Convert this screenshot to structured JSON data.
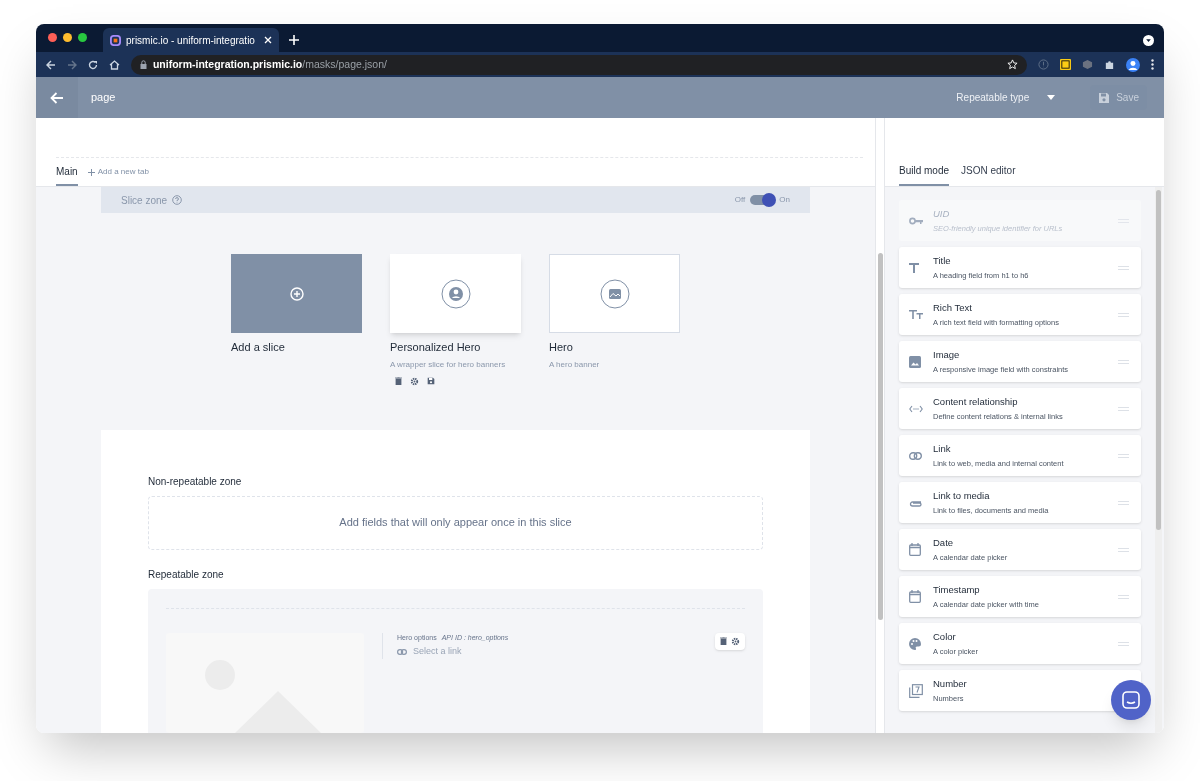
{
  "browser": {
    "tab_title": "prismic.io - uniform-integratio",
    "url_host": "uniform-integration.prismic.io",
    "url_path": "/masks/page.json/"
  },
  "header": {
    "title": "page",
    "type_label": "Repeatable type",
    "save": {
      "label": "Save",
      "disabled": true
    }
  },
  "tabs": [
    {
      "label": "Main",
      "selected": true
    }
  ],
  "add_tab": "Add a new tab",
  "slice_zone": {
    "label": "Slice zone",
    "off_label": "Off",
    "on_label": "On",
    "on": true
  },
  "slices": [
    {
      "kind": "add",
      "title": "Add a slice"
    },
    {
      "kind": "slice",
      "title": "Personalized Hero",
      "description": "A wrapper slice for hero banners",
      "selected": false,
      "actions": true
    },
    {
      "kind": "slice",
      "title": "Hero",
      "description": "A hero banner",
      "selected": true,
      "actions": false
    }
  ],
  "non_repeatable": {
    "label": "Non-repeatable zone",
    "empty_text": "Add fields that will only appear once in this slice"
  },
  "repeatable": {
    "label": "Repeatable zone",
    "field": {
      "label": "Hero options",
      "api_id": "API ID : hero_options",
      "placeholder": "Select a link"
    }
  },
  "side_tabs": [
    {
      "label": "Build mode",
      "selected": true
    },
    {
      "label": "JSON editor",
      "selected": false
    }
  ],
  "fields": [
    {
      "kind": "uid",
      "title": "UID",
      "description": "SEO-friendly unique identifier for URLs",
      "disabled": true
    },
    {
      "kind": "title",
      "title": "Title",
      "description": "A heading field from h1 to h6",
      "disabled": false
    },
    {
      "kind": "rich_text",
      "title": "Rich Text",
      "description": "A rich text field with formatting options",
      "disabled": false
    },
    {
      "kind": "image",
      "title": "Image",
      "description": "A responsive image field with constraints",
      "disabled": false
    },
    {
      "kind": "content_relationship",
      "title": "Content relationship",
      "description": "Define content relations & internal links",
      "disabled": false
    },
    {
      "kind": "link",
      "title": "Link",
      "description": "Link to web, media and internal content",
      "disabled": false
    },
    {
      "kind": "link_to_media",
      "title": "Link to media",
      "description": "Link to files, documents and media",
      "disabled": false
    },
    {
      "kind": "date",
      "title": "Date",
      "description": "A calendar date picker",
      "disabled": false
    },
    {
      "kind": "timestamp",
      "title": "Timestamp",
      "description": "A calendar date picker with time",
      "disabled": false
    },
    {
      "kind": "color",
      "title": "Color",
      "description": "A color picker",
      "disabled": false
    },
    {
      "kind": "number",
      "title": "Number",
      "description": "Numbers",
      "disabled": false
    }
  ]
}
